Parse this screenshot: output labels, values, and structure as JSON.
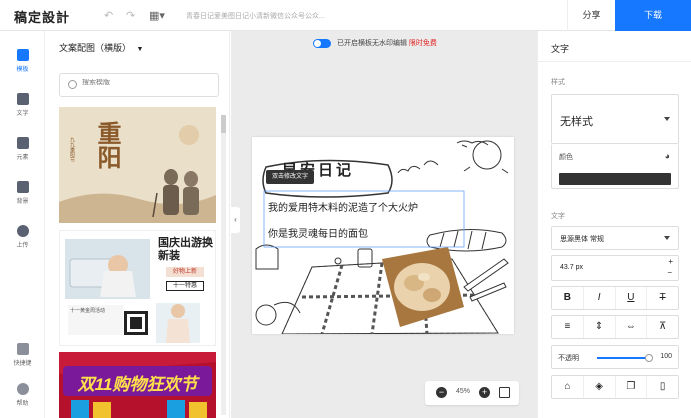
{
  "app": {
    "logo": "稿定設計",
    "doc_title": "青春日记爱美图日记小清新微信公众号公众...",
    "share_label": "分享",
    "download_label": "下载"
  },
  "nav": {
    "items": [
      {
        "label": "模板",
        "icon": "template-icon"
      },
      {
        "label": "文字",
        "icon": "text-icon"
      },
      {
        "label": "元素",
        "icon": "element-icon"
      },
      {
        "label": "背景",
        "icon": "background-icon"
      },
      {
        "label": "上传",
        "icon": "upload-icon"
      },
      {
        "label": "快捷键",
        "icon": "keyboard-icon"
      },
      {
        "label": "帮助",
        "icon": "help-icon"
      }
    ]
  },
  "panel": {
    "title": "文案配图（横版）",
    "search_placeholder": "搜索模版",
    "thumbs": [
      {
        "title": "重阳",
        "tag": "九九重阳节"
      },
      {
        "title": "国庆出游换新装",
        "sub": "好物上新",
        "sub2": "十一特惠",
        "note": "十一黄金周活动"
      },
      {
        "title": "双11购物狂欢节"
      }
    ]
  },
  "canvas": {
    "watermark_text": "已开启横板无水印编辑",
    "watermark_link": "限时免费",
    "tooltip": "双击修改文字",
    "heading": "早安日记",
    "line1": "我的爱用特木料的泥造了个大火炉",
    "line2": "你是我灵魂每日的面包",
    "zoom_value": "45%"
  },
  "right": {
    "title": "文字",
    "style_label": "样式",
    "style_value": "无样式",
    "color_label": "颜色",
    "text_color": "#333333",
    "font_label": "文字",
    "font_value": "思源黑体 常规",
    "size_value": "43.7 px",
    "opacity_label": "不透明",
    "opacity_value": "100"
  },
  "colors": {
    "accent": "#1677ff",
    "link_red": "#e02020"
  }
}
